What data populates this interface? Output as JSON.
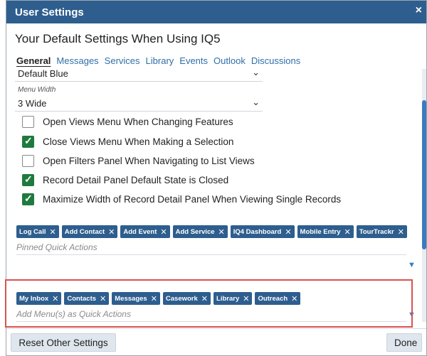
{
  "dialog": {
    "title": "User Settings",
    "close_symbol": "×"
  },
  "heading": "Your Default Settings When Using IQ5",
  "tabs": [
    {
      "label": "General",
      "active": true
    },
    {
      "label": "Messages"
    },
    {
      "label": "Services"
    },
    {
      "label": "Library"
    },
    {
      "label": "Events"
    },
    {
      "label": "Outlook"
    },
    {
      "label": "Discussions"
    }
  ],
  "theme_select": {
    "value": "Default Blue"
  },
  "menu_width": {
    "label": "Menu Width",
    "value": "3 Wide"
  },
  "checkboxes": [
    {
      "label": "Open Views Menu When Changing Features",
      "checked": false
    },
    {
      "label": "Close Views Menu When Making a Selection",
      "checked": true
    },
    {
      "label": "Open Filters Panel When Navigating to List Views",
      "checked": false
    },
    {
      "label": "Record Detail Panel Default State is Closed",
      "checked": true
    },
    {
      "label": "Maximize Width of Record Detail Panel When Viewing Single Records",
      "checked": true
    }
  ],
  "pinned_quick_actions": {
    "chips": [
      "Log Call",
      "Add Contact",
      "Add Event",
      "Add Service",
      "IQ4 Dashboard",
      "Mobile Entry",
      "TourTrackr"
    ],
    "placeholder": "Pinned Quick Actions"
  },
  "menu_quick_actions": {
    "chips": [
      "My Inbox",
      "Contacts",
      "Messages",
      "Casework",
      "Library",
      "Outreach"
    ],
    "placeholder": "Add Menu(s) as Quick Actions"
  },
  "footer": {
    "reset_label": "Reset Other Settings",
    "done_label": "Done"
  },
  "colors": {
    "titlebar": "#2e5e8e",
    "chip": "#2e5e8e",
    "check": "#1f7a3e",
    "highlight": "#d9534f",
    "link": "#2f6fa8"
  }
}
